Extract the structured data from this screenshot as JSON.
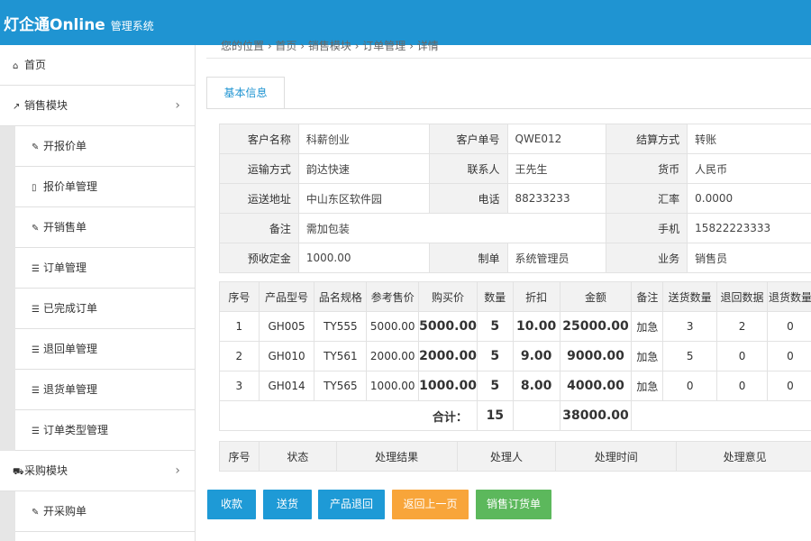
{
  "header": {
    "brand": "灯企通Online",
    "brand_sub": "管理系统"
  },
  "sidebar": {
    "home": "首页",
    "sales_module": "销售模块",
    "items": [
      "开报价单",
      "报价单管理",
      "开销售单",
      "订单管理",
      "已完成订单",
      "退回单管理",
      "退货单管理",
      "订单类型管理"
    ],
    "purchase_module": "采购模块",
    "purchase_items": [
      "开采购单"
    ]
  },
  "breadcrumb": "您的位置 › 首页 › 销售模块 › 订单管理 › 详情",
  "tab": "基本信息",
  "info": {
    "customer_name_label": "客户名称",
    "customer_name": "科薪创业",
    "customer_no_label": "客户单号",
    "customer_no": "QWE012",
    "settle_label": "结算方式",
    "settle": "转账",
    "transport_label": "运输方式",
    "transport": "韵达快速",
    "contact_label": "联系人",
    "contact": "王先生",
    "currency_label": "货币",
    "currency": "人民币",
    "address_label": "运送地址",
    "address": "中山东区软件园",
    "phone_label": "电话",
    "phone": "88233233",
    "rate_label": "汇率",
    "rate": "0.0000",
    "remark_label": "备注",
    "remark": "需加包装",
    "mobile_label": "手机",
    "mobile": "15822223333",
    "deposit_label": "预收定金",
    "deposit": "1000.00",
    "maker_label": "制单",
    "maker": "系统管理员",
    "business_label": "业务",
    "business": "销售员"
  },
  "products": {
    "headers": [
      "序号",
      "产品型号",
      "品名规格",
      "参考售价",
      "购买价",
      "数量",
      "折扣",
      "金额",
      "备注",
      "送货数量",
      "退回数据",
      "退货数量"
    ],
    "rows": [
      [
        "1",
        "GH005",
        "TY555",
        "5000.00",
        "5000.00",
        "5",
        "10.00",
        "25000.00",
        "加急",
        "3",
        "2",
        "0"
      ],
      [
        "2",
        "GH010",
        "TY561",
        "2000.00",
        "2000.00",
        "5",
        "9.00",
        "9000.00",
        "加急",
        "5",
        "0",
        "0"
      ],
      [
        "3",
        "GH014",
        "TY565",
        "1000.00",
        "1000.00",
        "5",
        "8.00",
        "4000.00",
        "加急",
        "0",
        "0",
        "0"
      ]
    ],
    "total_label": "合计：",
    "total_qty": "15",
    "total_amount": "38000.00"
  },
  "process": {
    "headers": [
      "序号",
      "状态",
      "处理结果",
      "处理人",
      "处理时间",
      "处理意见"
    ]
  },
  "buttons": {
    "collect": "收款",
    "deliver": "送货",
    "return_product": "产品退回",
    "back": "返回上一页",
    "sales_order": "销售订货单"
  },
  "colors": {
    "header": "#1f94d2",
    "blue_btn": "#1e9ad6",
    "orange_btn": "#f8a53a",
    "green_btn": "#5cb85c"
  }
}
